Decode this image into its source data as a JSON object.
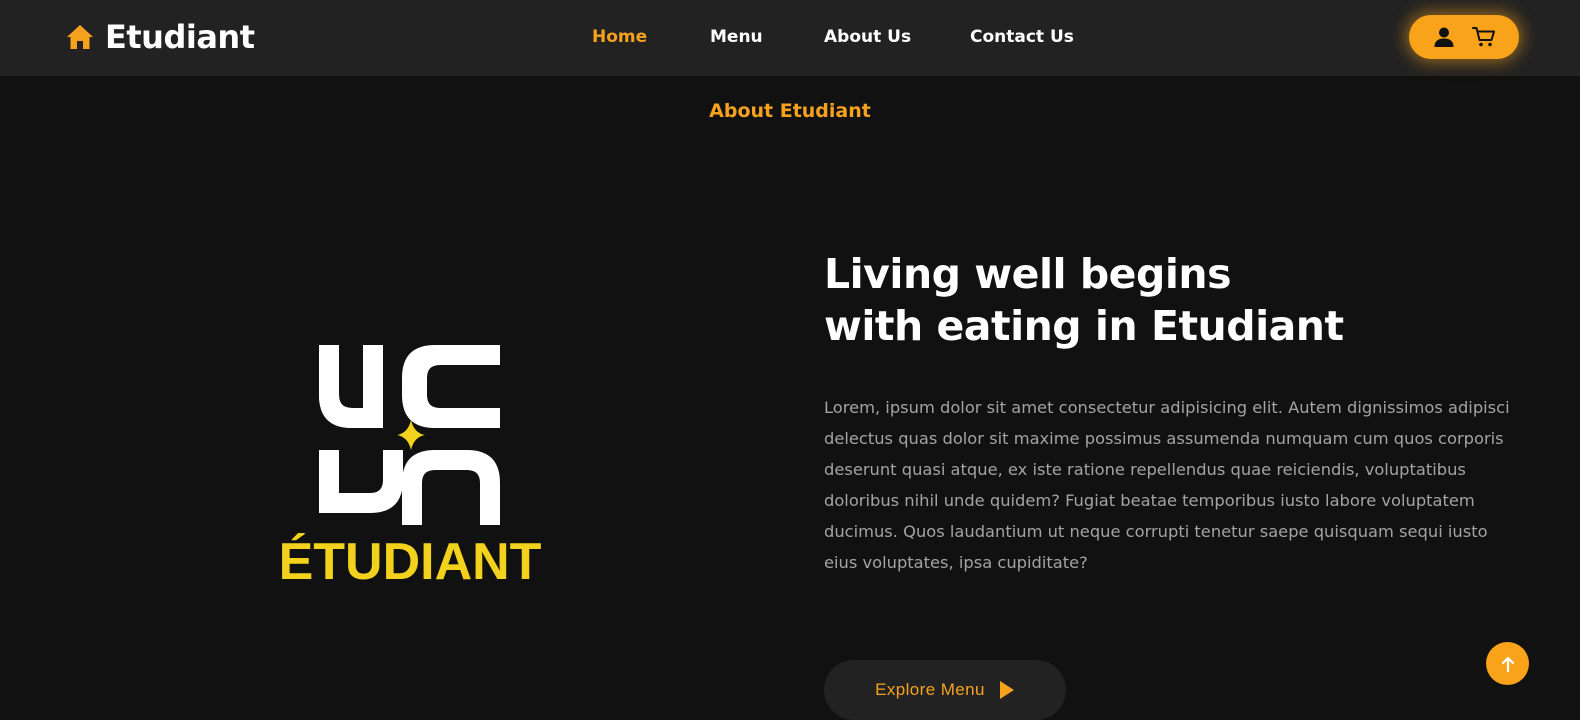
{
  "brand": {
    "name": "Etudiant",
    "icon": "home-icon",
    "accent_color": "#f6a21e"
  },
  "nav": {
    "items": [
      {
        "label": "Home",
        "active": true
      },
      {
        "label": "Menu",
        "active": false
      },
      {
        "label": "About Us",
        "active": false
      },
      {
        "label": "Contact Us",
        "active": false
      }
    ],
    "actions": [
      {
        "icon": "user-icon"
      },
      {
        "icon": "cart-icon"
      }
    ]
  },
  "about": {
    "section_label": "About Etudiant",
    "logo": {
      "text": "ÉTUDIANT",
      "mark_text": "UC DN",
      "text_color": "#f2d21c"
    },
    "headline": [
      "Living well begins",
      "with eating in Etudiant"
    ],
    "body": "Lorem, ipsum dolor sit amet consectetur adipisicing elit. Autem dignissimos adipisci delectus quas dolor sit maxime possimus assumenda numquam cum quos corporis deserunt quasi atque, ex iste ratione repellendus quae reiciendis, voluptatibus doloribus nihil unde quidem? Fugiat beatae temporibus iusto labore voluptatem ducimus. Quos laudantium ut neque corrupti tenetur saepe quisquam sequi iusto eius voluptates, ipsa cupiditate?",
    "cta": {
      "label": "Explore Menu",
      "icon": "play-icon"
    }
  },
  "scroll_top": {
    "icon": "arrow-up-icon"
  },
  "colors": {
    "background": "#111111",
    "navbar": "#222222",
    "accent": "#f9a31b",
    "body_text": "#a3a3a3"
  }
}
